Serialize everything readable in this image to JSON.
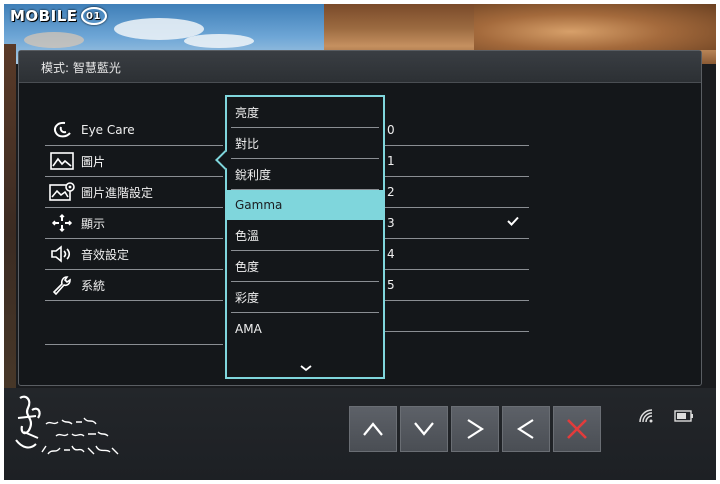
{
  "watermark": {
    "text": "MOBILE",
    "ring": "01"
  },
  "osd": {
    "header_title": "模式: 智慧藍光",
    "menu": [
      {
        "label": "Eye Care",
        "icon": "eye-care-icon"
      },
      {
        "label": "圖片",
        "icon": "picture-icon"
      },
      {
        "label": "圖片進階設定",
        "icon": "picture-advanced-icon"
      },
      {
        "label": "顯示",
        "icon": "display-icon"
      },
      {
        "label": "音效設定",
        "icon": "speaker-icon"
      },
      {
        "label": "系統",
        "icon": "wrench-icon"
      }
    ],
    "submenu": [
      {
        "label": "亮度"
      },
      {
        "label": "對比"
      },
      {
        "label": "銳利度"
      },
      {
        "label": "Gamma"
      },
      {
        "label": "色溫"
      },
      {
        "label": "色度"
      },
      {
        "label": "彩度"
      },
      {
        "label": "AMA"
      }
    ],
    "values": [
      "0",
      "1",
      "2",
      "3",
      "4",
      "5"
    ],
    "selected_value": "3",
    "accent_color": "#7fd6dc"
  },
  "buttons": [
    "up-button",
    "down-button",
    "enter-button",
    "back-button",
    "exit-button"
  ],
  "status_icons": [
    "wireless-icon",
    "battery-icon"
  ]
}
